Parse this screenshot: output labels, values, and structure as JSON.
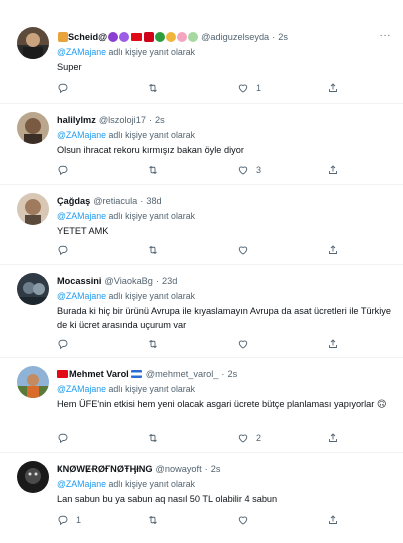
{
  "reply_prefix": "@ZAMajane",
  "reply_suffix": " adlı kişiye yanıt olarak",
  "more_label": "···",
  "tweets": [
    {
      "name": "Scheid@",
      "handle": "@adiguzelseyda",
      "time": "2s",
      "text": "Super",
      "reply_count": "",
      "retweet_count": "",
      "like_count": "1",
      "share_count": ""
    },
    {
      "name": "halilylmz",
      "handle": "@lszoloji17",
      "time": "2s",
      "text": "Olsun ihracat rekoru kırmışız bakan öyle diyor",
      "reply_count": "",
      "retweet_count": "",
      "like_count": "3",
      "share_count": ""
    },
    {
      "name": "Çağdaş",
      "handle": "@retiacula",
      "time": "38d",
      "text": "YETET AMK",
      "reply_count": "",
      "retweet_count": "",
      "like_count": "",
      "share_count": ""
    },
    {
      "name": "Mocassini",
      "handle": "@ViaokaBg",
      "time": "23d",
      "text": "Burada ki hiç bir ürünü Avrupa ile kıyaslamayın Avrupa da asat ücretleri ile Türkiye de ki ücret arasında uçurum var",
      "reply_count": "",
      "retweet_count": "",
      "like_count": "",
      "share_count": ""
    },
    {
      "name": "Mehmet Varol",
      "handle": "@mehmet_varol_",
      "time": "2s",
      "text": "Hem ÜFE'nin etkisi hem yeni olacak asgari ücrete bütçe planlaması yapıyorlar 🙃",
      "reply_count": "",
      "retweet_count": "",
      "like_count": "2",
      "share_count": ""
    },
    {
      "name": "ҜNØWɆɌØҒNØŦӉłNG",
      "handle": "@nowayoft",
      "time": "2s",
      "text": "Lan sabun bu ya sabun aq nasıl 50 TL olabilir 4 sabun",
      "reply_count": "1",
      "retweet_count": "",
      "like_count": "",
      "share_count": ""
    }
  ]
}
